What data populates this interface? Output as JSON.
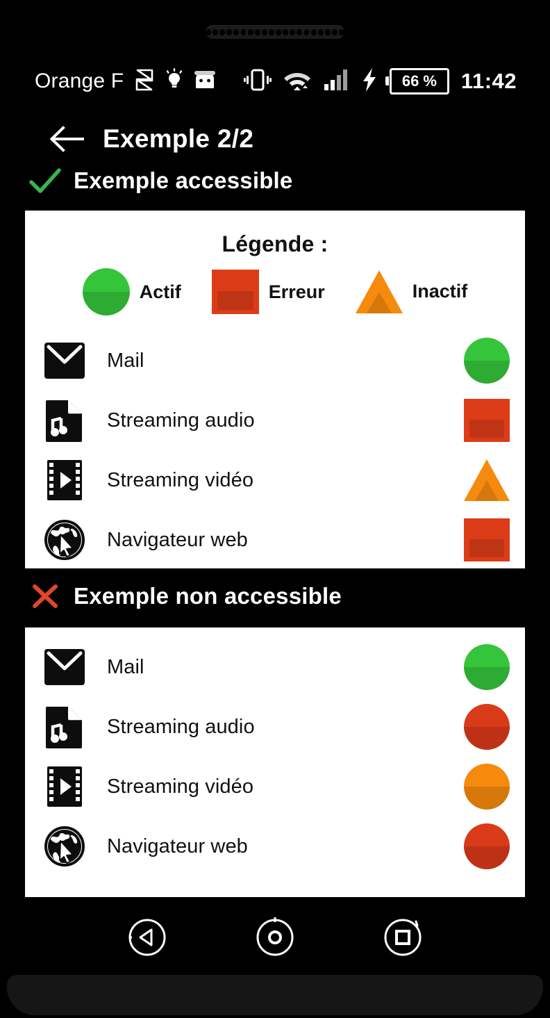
{
  "status_bar": {
    "carrier": "Orange F",
    "icons": [
      "sfr-s-icon",
      "lightbulb-icon",
      "android-head-icon",
      "vibrate-icon",
      "wifi-icon",
      "cellular-signal-icon",
      "charging-bolt-icon"
    ],
    "battery_level": "66 %",
    "time": "11:42"
  },
  "app_bar": {
    "back_label": "back-arrow",
    "title": "Exemple 2/2"
  },
  "sections": {
    "accessible": {
      "mark": "check",
      "mark_color": "#3ab54a",
      "title": "Exemple accessible"
    },
    "inaccessible": {
      "mark": "cross",
      "mark_color": "#e2452f",
      "title": "Exemple non accessible"
    }
  },
  "legend": {
    "title": "Légende :",
    "items": [
      {
        "shape": "circle",
        "label": "Actif",
        "color": "#35c53a"
      },
      {
        "shape": "square",
        "label": "Erreur",
        "color": "#dc3c17"
      },
      {
        "shape": "triangle",
        "label": "Inactif",
        "color": "#f68a0c"
      }
    ]
  },
  "accessible_rows": [
    {
      "icon": "mail-icon",
      "label": "Mail",
      "shape": "circle",
      "color": "#35c53a",
      "state": "Actif"
    },
    {
      "icon": "audio-file-icon",
      "label": "Streaming audio",
      "shape": "square",
      "color": "#dc3c17",
      "state": "Erreur"
    },
    {
      "icon": "film-icon",
      "label": "Streaming vidéo",
      "shape": "triangle",
      "color": "#f68a0c",
      "state": "Inactif"
    },
    {
      "icon": "globe-icon",
      "label": "Navigateur web",
      "shape": "square",
      "color": "#dc3c17",
      "state": "Erreur"
    }
  ],
  "inaccessible_rows": [
    {
      "icon": "mail-icon",
      "label": "Mail",
      "shape": "circle",
      "color": "#35c53a"
    },
    {
      "icon": "audio-file-icon",
      "label": "Streaming audio",
      "shape": "circle",
      "color": "#d93a17"
    },
    {
      "icon": "film-icon",
      "label": "Streaming vidéo",
      "shape": "circle",
      "color": "#f68a0c"
    },
    {
      "icon": "globe-icon",
      "label": "Navigateur web",
      "shape": "circle",
      "color": "#d93a17"
    }
  ],
  "nav_bar": {
    "back": "nav-back-icon",
    "home": "nav-home-icon",
    "recents": "nav-recents-icon"
  }
}
